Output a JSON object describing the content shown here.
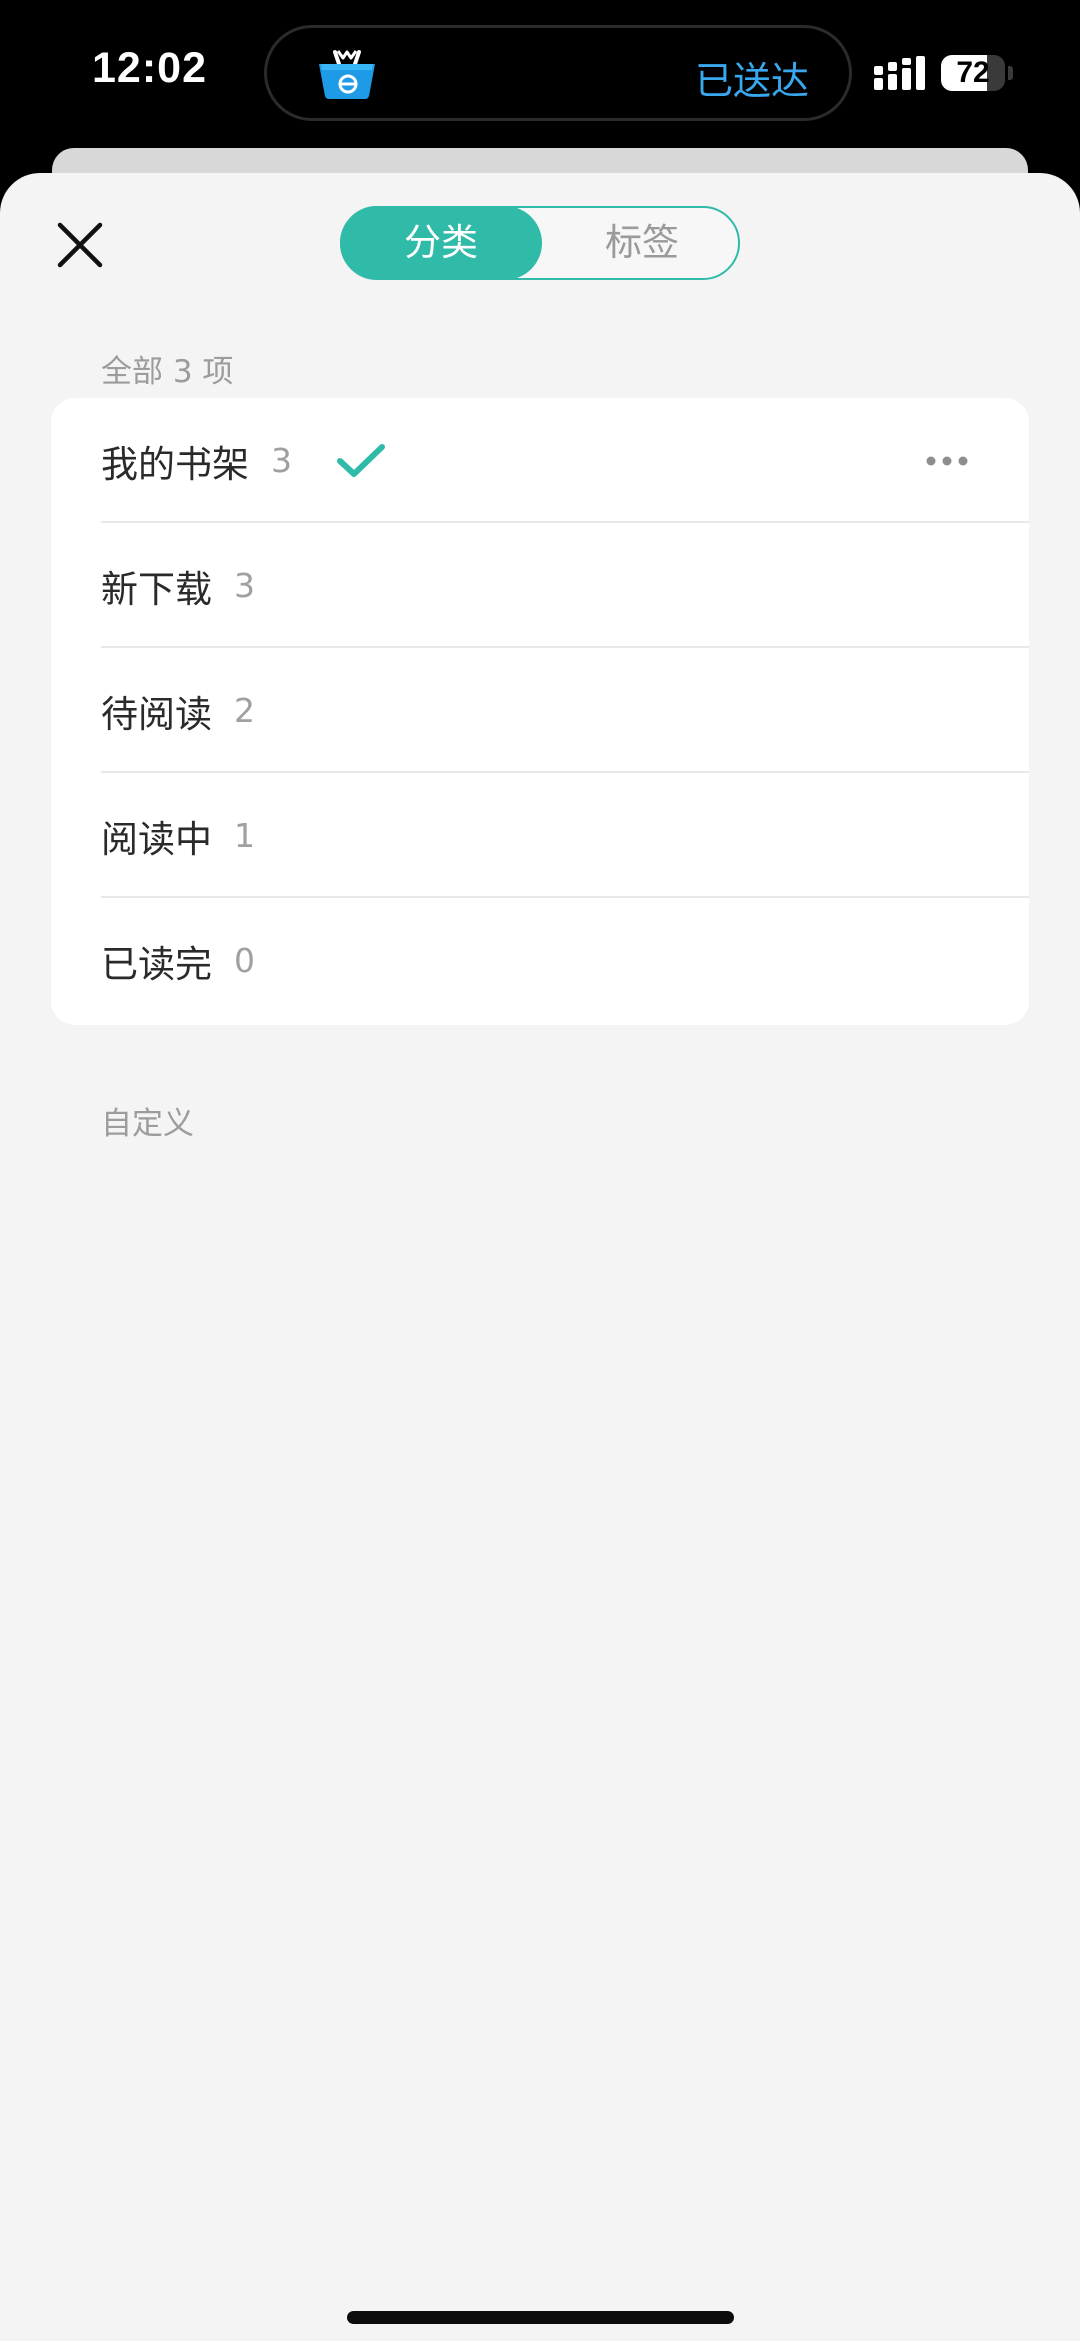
{
  "status_bar": {
    "time": "12:02",
    "island_text": "已送达",
    "island_icon": "shopping-basket-app-icon",
    "battery_percent": 72,
    "battery_text": "72"
  },
  "tabs": {
    "active_label": "分类",
    "inactive_label": "标签"
  },
  "all_section": {
    "label": "全部 3 项"
  },
  "categories": [
    {
      "name": "我的书架",
      "count": "3",
      "selected": true
    },
    {
      "name": "新下载",
      "count": "3"
    },
    {
      "name": "待阅读",
      "count": "2"
    },
    {
      "name": "阅读中",
      "count": "1"
    },
    {
      "name": "已读完",
      "count": "0"
    }
  ],
  "custom_section": {
    "label": "自定义"
  },
  "colors": {
    "accent": "#2fbba8",
    "island_text": "#3aa8ee",
    "background": "#f4f4f4"
  }
}
